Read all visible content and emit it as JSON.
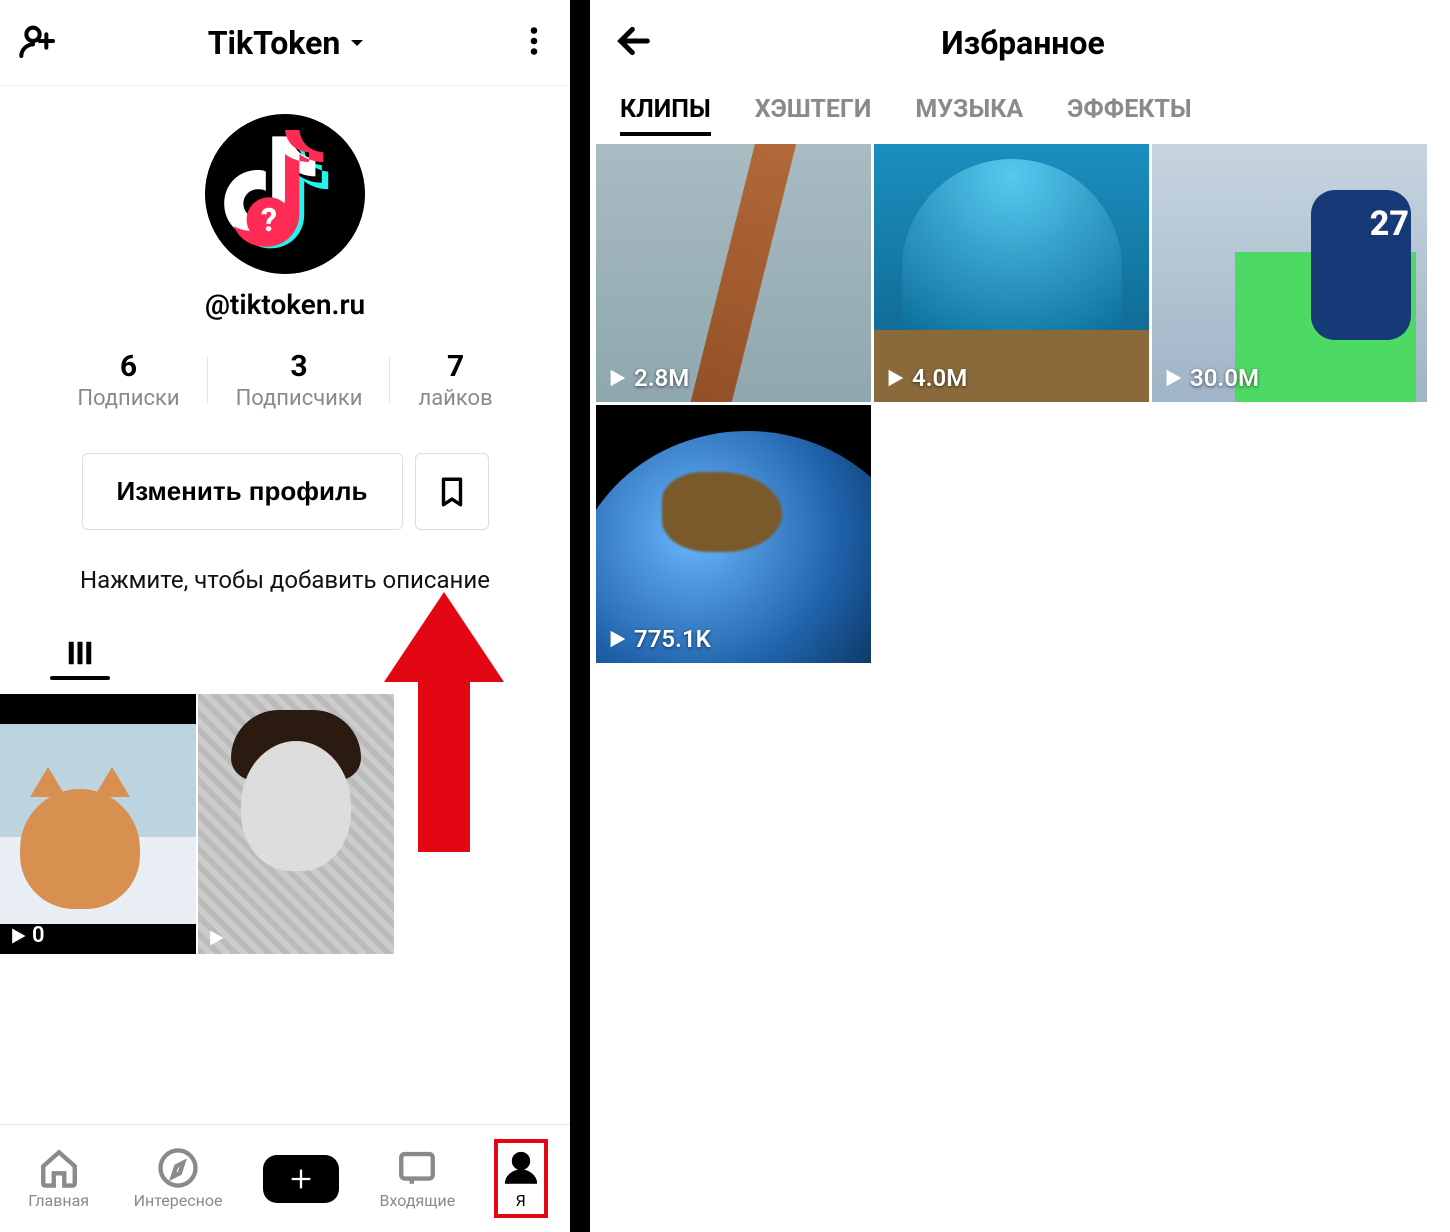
{
  "left": {
    "header": {
      "title": "TikToken"
    },
    "handle": "@tiktoken.ru",
    "stats": {
      "following_count": "6",
      "following_label": "Подписки",
      "followers_count": "3",
      "followers_label": "Подписчики",
      "likes_count": "7",
      "likes_label": "лайков"
    },
    "edit_profile_label": "Изменить профиль",
    "bio_hint": "Нажмите, чтобы добавить описание",
    "videos": [
      {
        "views": "0"
      },
      {
        "views": ""
      }
    ],
    "nav": {
      "home": "Главная",
      "discover": "Интересное",
      "inbox": "Входящие",
      "me": "Я"
    }
  },
  "right": {
    "title": "Избранное",
    "tabs": {
      "clips": "КЛИПЫ",
      "hashtags": "ХЭШТЕГИ",
      "music": "МУЗЫКА",
      "effects": "ЭФФЕКТЫ"
    },
    "clips": [
      {
        "views": "2.8M",
        "kind": "rope"
      },
      {
        "views": "4.0M",
        "kind": "under"
      },
      {
        "views": "30.0M",
        "kind": "hockey",
        "jersey_number": "27"
      },
      {
        "views": "775.1K",
        "kind": "earth"
      }
    ]
  }
}
